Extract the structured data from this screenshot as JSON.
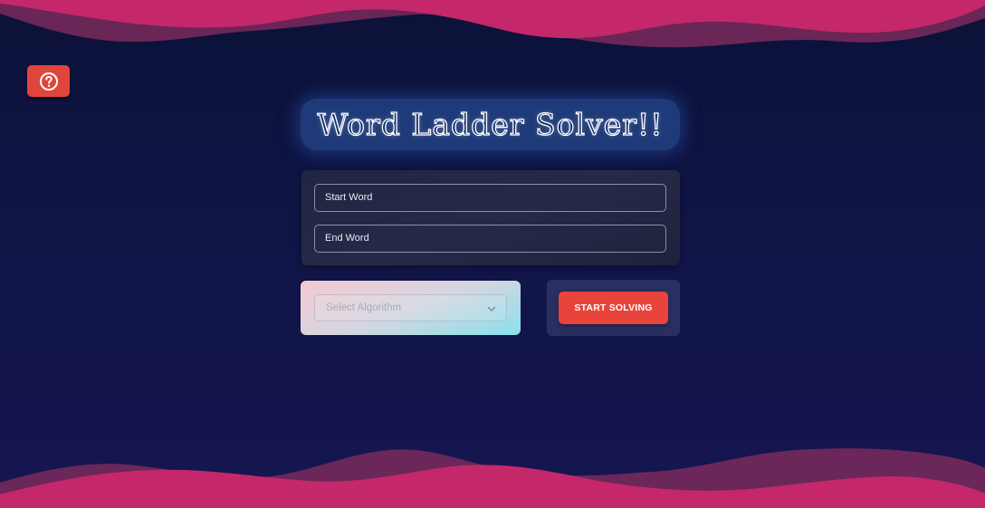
{
  "help": {
    "icon": "question-circle-icon",
    "color": "#e0453c"
  },
  "title": "Word Ladder Solver!!",
  "inputs": {
    "start_label": "Start Word",
    "end_label": "End Word"
  },
  "algorithm": {
    "placeholder": "Select Algorithm",
    "icon": "chevron-down-icon"
  },
  "solve_button": {
    "label": "START SOLVING",
    "color": "#e9443b"
  },
  "colors": {
    "background": "#0f1442",
    "wave_pink": "#c4286a",
    "wave_dark": "#7a2a5c",
    "title_pill": "#1e3a78"
  }
}
